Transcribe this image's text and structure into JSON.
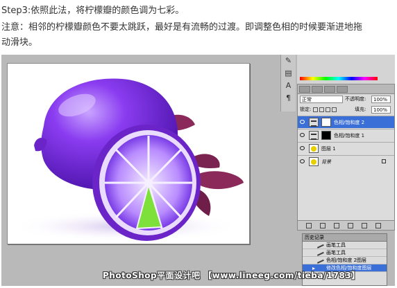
{
  "instructions": {
    "line1": "Step3:依照此法，将柠檬瓣的颜色调为七彩。",
    "line2": "注意：相邻的柠檬瓣颜色不要太跳跃，最好是有流畅的过渡。即调整色相的时候要渐进地拖",
    "line3": "动滑块。"
  },
  "toolstrip": [
    "✎",
    "▤",
    "A",
    "¶"
  ],
  "layers_panel": {
    "blend_mode": "正常",
    "opacity_label": "不透明度:",
    "opacity_value": "100%",
    "lock_label": "锁定:",
    "fill_label": "填充:",
    "fill_value": "100%",
    "layers": [
      {
        "name": "色相/饱和度 2",
        "selected": true
      },
      {
        "name": "色相/饱和度 1",
        "selected": false
      },
      {
        "name": "图层 1",
        "selected": false
      },
      {
        "name": "背景",
        "selected": false
      }
    ]
  },
  "history_panel": {
    "title": "历史记录",
    "items": [
      {
        "label": "画笔工具",
        "selected": false
      },
      {
        "label": "画笔工具",
        "selected": false
      },
      {
        "label": "色相/饱和度 2图层",
        "selected": false
      },
      {
        "label": "修改色相/饱和度图层",
        "selected": true
      }
    ]
  },
  "watermark": "PhotoShop平面设计吧 【www.lineeg.com/tieba/1783】",
  "colors": {
    "lemon_purple": "#8a3cf0",
    "slice_light": "#b98cff",
    "wedge_green": "#7ee03a",
    "leaf": "#8b2a5a",
    "selection_blue": "#3a6fd8"
  }
}
